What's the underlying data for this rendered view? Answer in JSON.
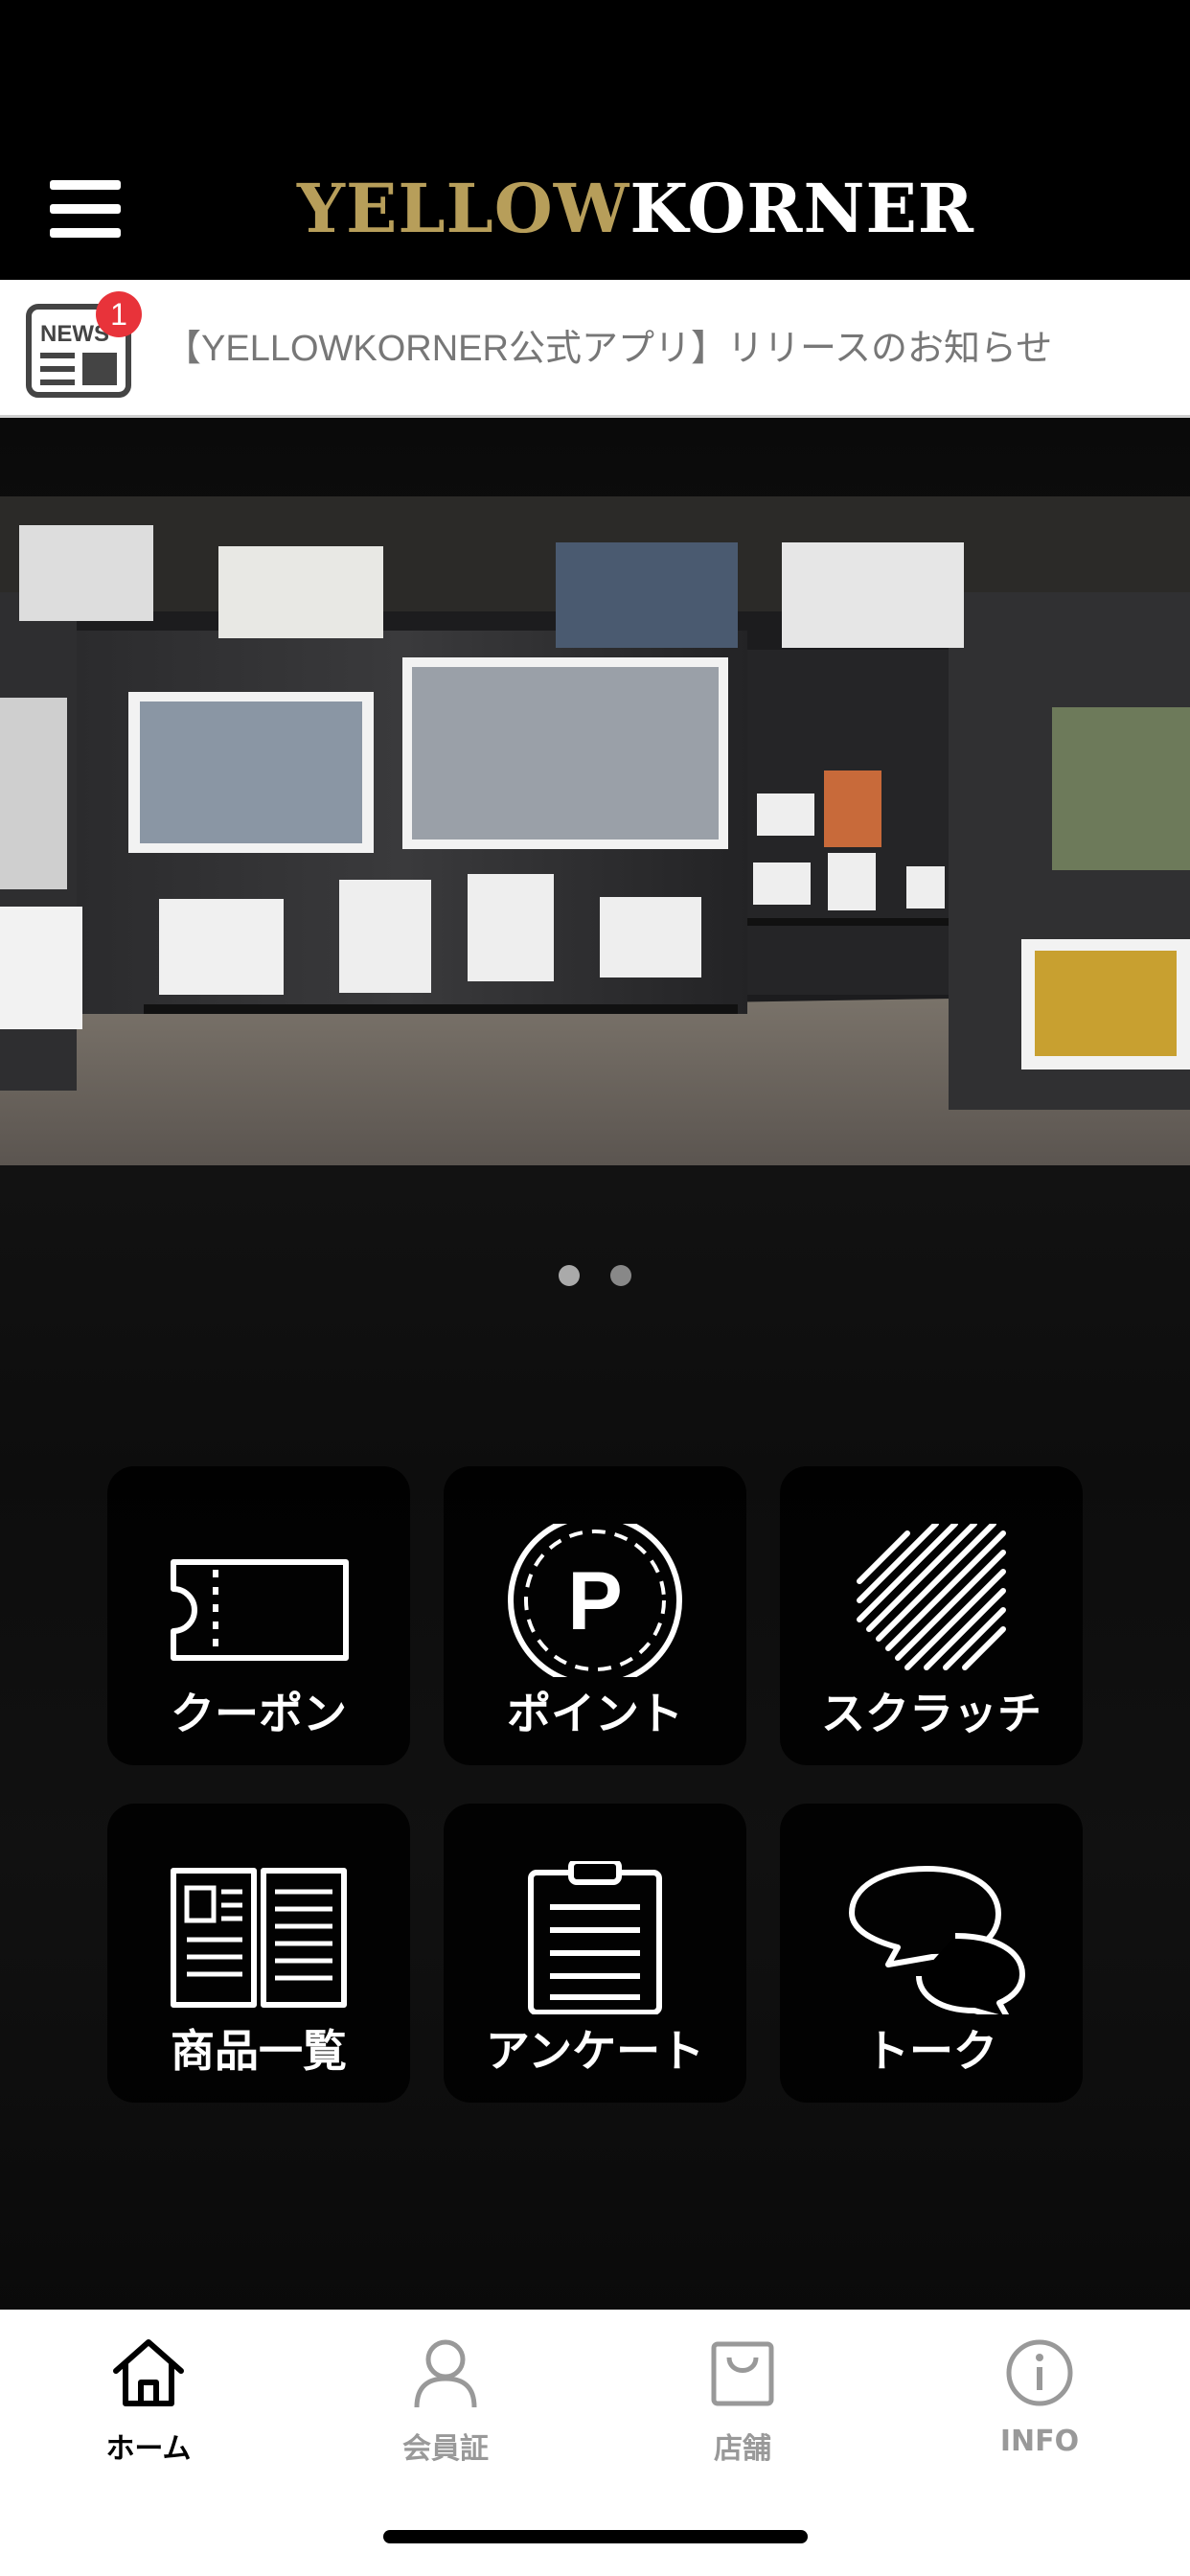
{
  "header": {
    "logo_part1": "YELLOW",
    "logo_part2": "KORNER",
    "menu_icon": "hamburger-menu-icon"
  },
  "news": {
    "icon": "newspaper-icon",
    "icon_label": "NEWS",
    "badge_count": "1",
    "title": "【YELLOWKORNER公式アプリ】リリースのお知らせ"
  },
  "carousel": {
    "slide_count": 2,
    "active_index": 0
  },
  "tiles": [
    {
      "label": "クーポン",
      "icon": "coupon-icon"
    },
    {
      "label": "ポイント",
      "icon": "point-icon"
    },
    {
      "label": "スクラッチ",
      "icon": "scratch-icon"
    },
    {
      "label": "商品一覧",
      "icon": "catalog-icon"
    },
    {
      "label": "アンケート",
      "icon": "survey-icon"
    },
    {
      "label": "トーク",
      "icon": "chat-icon"
    }
  ],
  "bottom_nav": [
    {
      "label": "ホーム",
      "icon": "home-icon",
      "active": true
    },
    {
      "label": "会員証",
      "icon": "member-icon",
      "active": false
    },
    {
      "label": "店舗",
      "icon": "store-icon",
      "active": false
    },
    {
      "label": "INFO",
      "icon": "info-icon",
      "active": false
    }
  ],
  "colors": {
    "logo_gold": "#b79e5a",
    "badge_red": "#e8333a",
    "nav_inactive": "#999999",
    "nav_active": "#000000"
  }
}
